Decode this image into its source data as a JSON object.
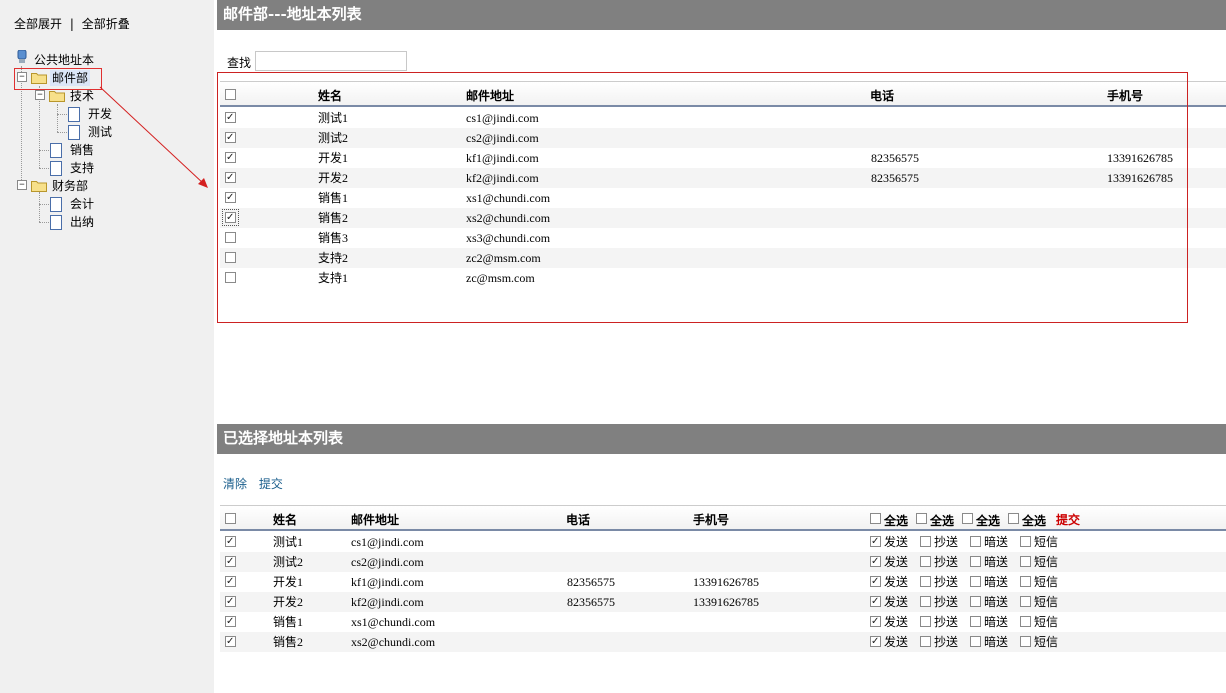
{
  "sidebar": {
    "expand_all": "全部展开",
    "collapse_all": "全部折叠",
    "separator": "|",
    "tree": {
      "root": "公共地址本",
      "mail_dept": "邮件部",
      "tech": "技术",
      "dev": "开发",
      "test": "测试",
      "sales": "销售",
      "support": "支持",
      "finance": "财务部",
      "accounting": "会计",
      "cashier": "出纳"
    }
  },
  "address_list": {
    "title": "邮件部---地址本列表",
    "search_label": "查找",
    "search_value": "",
    "columns": {
      "name": "姓名",
      "email": "邮件地址",
      "phone": "电话",
      "mobile": "手机号"
    },
    "rows": [
      {
        "checked": true,
        "name": "测试1",
        "email": "cs1@jindi.com",
        "phone": "",
        "mobile": ""
      },
      {
        "checked": true,
        "name": "测试2",
        "email": "cs2@jindi.com",
        "phone": "",
        "mobile": ""
      },
      {
        "checked": true,
        "name": "开发1",
        "email": "kf1@jindi.com",
        "phone": "82356575",
        "mobile": "13391626785"
      },
      {
        "checked": true,
        "name": "开发2",
        "email": "kf2@jindi.com",
        "phone": "82356575",
        "mobile": "13391626785"
      },
      {
        "checked": true,
        "name": "销售1",
        "email": "xs1@chundi.com",
        "phone": "",
        "mobile": ""
      },
      {
        "checked": true,
        "name": "销售2",
        "email": "xs2@chundi.com",
        "phone": "",
        "mobile": ""
      },
      {
        "checked": false,
        "name": "销售3",
        "email": "xs3@chundi.com",
        "phone": "",
        "mobile": ""
      },
      {
        "checked": false,
        "name": "支持2",
        "email": "zc2@msm.com",
        "phone": "",
        "mobile": ""
      },
      {
        "checked": false,
        "name": "支持1",
        "email": "zc@msm.com",
        "phone": "",
        "mobile": ""
      }
    ]
  },
  "selected_list": {
    "title": "已选择地址本列表",
    "clear_label": "清除",
    "submit_label": "提交",
    "columns": {
      "name": "姓名",
      "email": "邮件地址",
      "phone": "电话",
      "mobile": "手机号"
    },
    "select_all_label": "全选",
    "submit_red_label": "提交",
    "option_labels": {
      "send": "发送",
      "cc": "抄送",
      "bcc": "暗送",
      "sms": "短信"
    },
    "rows": [
      {
        "name": "测试1",
        "email": "cs1@jindi.com",
        "phone": "",
        "mobile": ""
      },
      {
        "name": "测试2",
        "email": "cs2@jindi.com",
        "phone": "",
        "mobile": ""
      },
      {
        "name": "开发1",
        "email": "kf1@jindi.com",
        "phone": "82356575",
        "mobile": "13391626785"
      },
      {
        "name": "开发2",
        "email": "kf2@jindi.com",
        "phone": "82356575",
        "mobile": "13391626785"
      },
      {
        "name": "销售1",
        "email": "xs1@chundi.com",
        "phone": "",
        "mobile": ""
      },
      {
        "name": "销售2",
        "email": "xs2@chundi.com",
        "phone": "",
        "mobile": ""
      }
    ]
  },
  "colors": {
    "header_bg": "#808080",
    "highlight": "#cc2222",
    "link": "#1a5e8c",
    "submit_red": "#cc0000"
  }
}
